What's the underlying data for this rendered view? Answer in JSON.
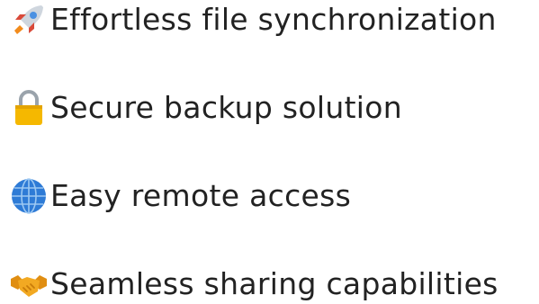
{
  "features": [
    {
      "icon": "rocket-icon",
      "label": "Effortless file synchronization"
    },
    {
      "icon": "lock-icon",
      "label": "Secure backup solution"
    },
    {
      "icon": "globe-icon",
      "label": "Easy remote access"
    },
    {
      "icon": "handshake-icon",
      "label": "Seamless sharing capabilities"
    }
  ],
  "colors": {
    "text": "#222222",
    "lock_body": "#F5B800",
    "lock_shackle": "#9AA3AB",
    "globe": "#2E7BD6",
    "rocket_body": "#CFD6DE",
    "rocket_flame": "#F28B1C",
    "handshake": "#F2A922"
  }
}
